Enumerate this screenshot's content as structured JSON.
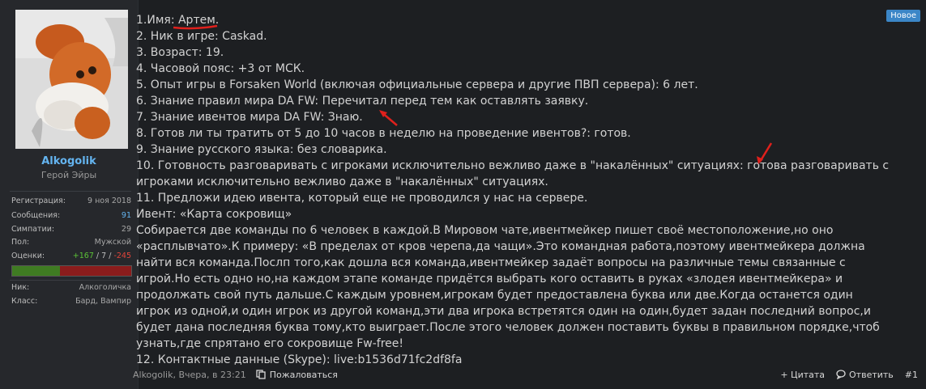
{
  "badge": "Новое",
  "user": {
    "name": "Alkogolik",
    "title": "Герой Эйры"
  },
  "stats": [
    {
      "label": "Регистрация:",
      "value": "9 ноя 2018"
    },
    {
      "label": "Сообщения:",
      "value": "91"
    },
    {
      "label": "Симпатии:",
      "value": "29"
    },
    {
      "label": "Пол:",
      "value": "Мужской"
    }
  ],
  "ratings": {
    "label": "Оценки:",
    "positive": "+167",
    "neutral": "7",
    "negative": "-245",
    "sep": " / "
  },
  "extra": [
    {
      "label": "Ник:",
      "value": "Алкоголичка"
    },
    {
      "label": "Класс:",
      "value": "Бард, Вампир"
    }
  ],
  "post": {
    "lines": [
      "1.Имя: Артем.",
      "2. Ник в игре: Caskad.",
      "3. Возраст: 19.",
      "4. Часовой пояс: +3 от МСК.",
      "5. Опыт игры в Forsaken World (включая официальные сервера и другие ПВП сервера): 6 лет.",
      "6. Знание правил мира DA FW: Перечитал перед тем как оставлять заявку.",
      "7. Знание ивентов мира DA FW: Знаю.",
      "8. Готов ли ты тратить от 5 до 10 часов в неделю на проведение ивентов?: готов.",
      "9. Знание русского языка: без словарика.",
      "10. Готовность разговаривать с игроками исключительно вежливо даже в \"накалённых\" ситуациях: готова разговаривать с игроками исключительно вежливо даже в \"накалённых\" ситуациях.",
      "11. Предложи идею ивента, который еще не проводился у нас на сервере.",
      "Ивент: «Карта сокровищ»",
      "Собирается две команды по 6 человек в каждой.В Мировом чате,ивентмейкер пишет своё местоположение,но оно «расплывчато».К примеру: «В пределах от кров черепа,да чащи».Это командная работа,поэтому ивентмейкера должна найти вся команда.Послп того,как дошла вся команда,ивентмейкер задаёт вопросы на различные темы связанные с игрой.Но есть одно но,на каждом этапе команде придётся выбрать кого оставить в руках «злодея ивентмейкера» и продолжать свой путь дальше.С каждым уровнем,игрокам будет предоставлена буква или две.Когда останется один игрок из одной,и один игрок из другой команд,эти два игрока встретятся один на один,будет задан последний вопрос,и будет дана последняя буква тому,кто выиграет.После этого человек должен поставить буквы в правильном порядке,чтоб узнать,где спрятано его сокровище Fw-free!",
      "12. Контактные данные (Skype): live:b1536d71fc2df8fa"
    ]
  },
  "footer": {
    "meta": "Alkogolik, Вчера, в 23:21",
    "report": "Пожаловаться",
    "quote": "+ Цитата",
    "reply": "Ответить",
    "number": "#1"
  },
  "colors": {
    "accent": "#64b4f0",
    "badge": "#3b86c7",
    "annotation": "#e0201c"
  }
}
